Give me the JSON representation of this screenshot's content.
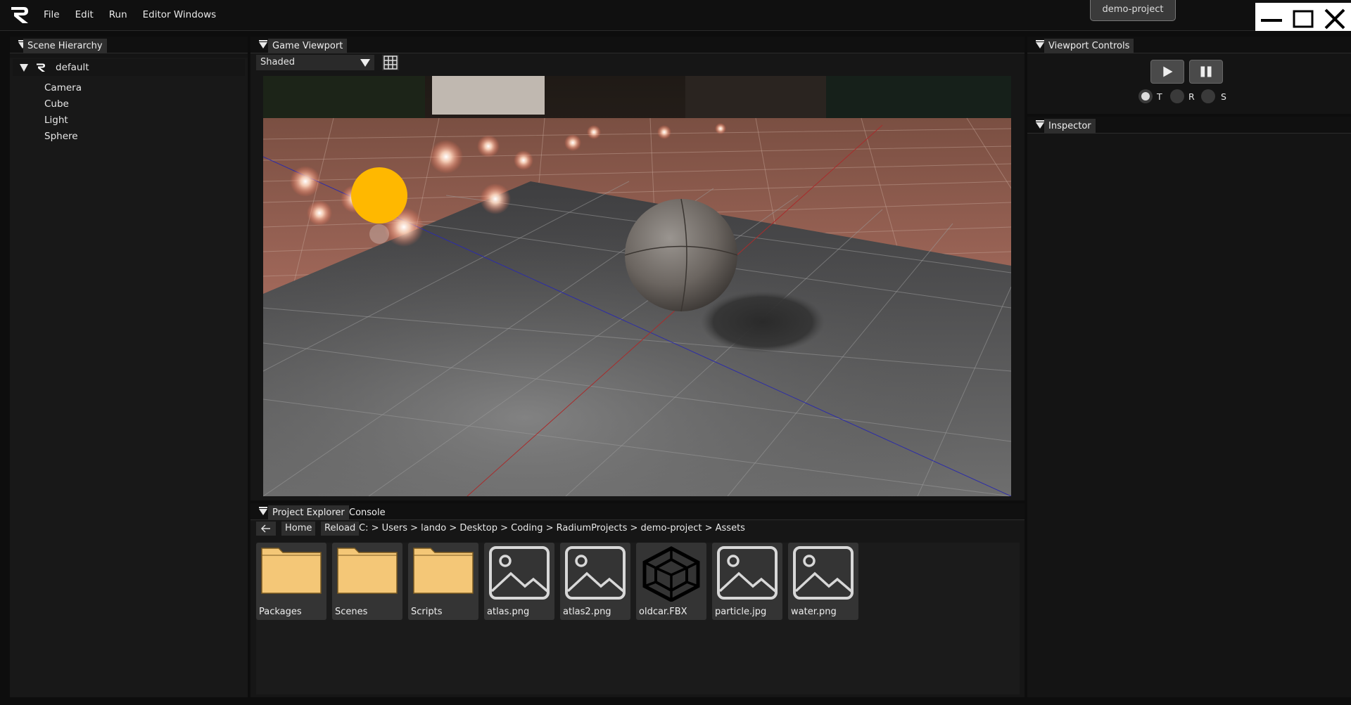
{
  "menu": [
    "File",
    "Edit",
    "Run",
    "Editor Windows"
  ],
  "project_tab": "demo-project",
  "hierarchy": {
    "title": "Scene Hierarchy",
    "root": "default",
    "items": [
      "Camera",
      "Cube",
      "Light",
      "Sphere"
    ]
  },
  "game": {
    "title": "Game Viewport",
    "shading_mode": "Shaded"
  },
  "viewport_controls": {
    "title": "Viewport Controls",
    "modes": [
      "T",
      "R",
      "S"
    ],
    "selected_mode": "T"
  },
  "inspector": {
    "title": "Inspector"
  },
  "project": {
    "tabs": [
      "Project Explorer",
      "Console"
    ],
    "home_label": "Home",
    "reload_label": "Reload",
    "path": "C: > Users > lando > Desktop > Coding > RadiumProjects > demo-project > Assets",
    "assets": [
      {
        "name": "Packages",
        "kind": "folder"
      },
      {
        "name": "Scenes",
        "kind": "folder"
      },
      {
        "name": "Scripts",
        "kind": "folder"
      },
      {
        "name": "atlas.png",
        "kind": "image"
      },
      {
        "name": "atlas2.png",
        "kind": "image"
      },
      {
        "name": "oldcar.FBX",
        "kind": "model"
      },
      {
        "name": "particle.jpg",
        "kind": "image"
      },
      {
        "name": "water.png",
        "kind": "image"
      }
    ]
  },
  "colors": {
    "background": "#0d0d0d",
    "panel": "#141414",
    "tab_active": "#2e2e2e",
    "folder": "#f4c777",
    "light_gizmo": "#ffb800"
  }
}
